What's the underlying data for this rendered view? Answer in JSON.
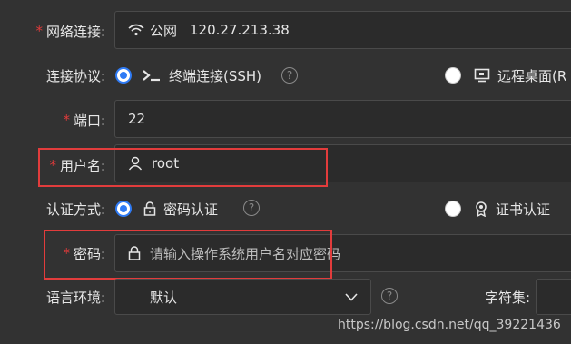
{
  "network": {
    "label": "网络连接:",
    "type": "公网",
    "ip": "120.27.213.38"
  },
  "protocol": {
    "label": "连接协议:",
    "ssh": "终端连接(SSH)",
    "rdp": "远程桌面(R"
  },
  "port": {
    "label": "端口:",
    "value": "22"
  },
  "username": {
    "label": "用户名:",
    "value": "root"
  },
  "auth": {
    "label": "认证方式:",
    "password": "密码认证",
    "cert": "证书认证"
  },
  "password": {
    "label": "密码:",
    "placeholder": "请输入操作系统用户名对应密码"
  },
  "language": {
    "label": "语言环境:",
    "value": "默认"
  },
  "charset": {
    "label": "字符集:"
  },
  "help_mark": "?",
  "required_mark": "*",
  "watermark": "https://blog.csdn.net/qq_39221436",
  "colors": {
    "accent": "#2f7bf5",
    "required": "#e03b3b",
    "highlight": "#e23c3c",
    "background": "#323232"
  }
}
